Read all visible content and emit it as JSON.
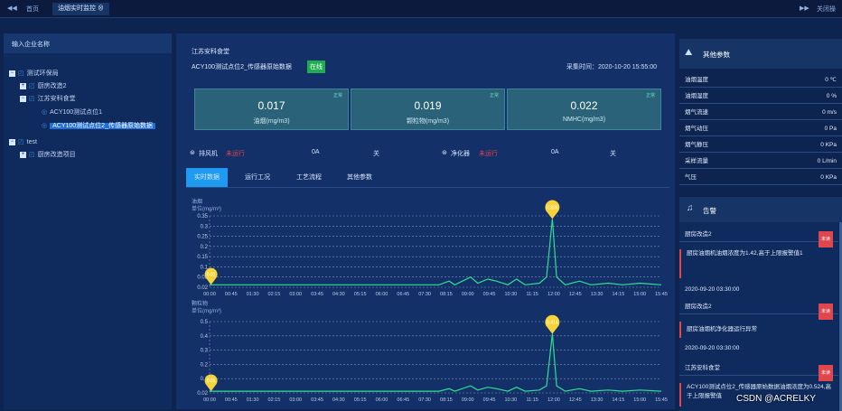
{
  "topbar": {
    "back_icon": "double-left",
    "home": "首页",
    "tab": "油烟实时监控",
    "fwd_icon": "double-right",
    "close_all": "关闭操"
  },
  "sidebar": {
    "header": "输入企业名称",
    "tree": [
      {
        "label": "测试环保局",
        "expand": "−"
      },
      {
        "label": "厨房改造2",
        "expand": "+"
      },
      {
        "label": "江苏安科食堂",
        "expand": "−"
      },
      {
        "label": "ACY100测试点位1"
      },
      {
        "label": "ACY100测试点位2_传感器原始数据"
      },
      {
        "label": "test",
        "expand": "−"
      },
      {
        "label": "厨房改造项目",
        "expand": "+"
      }
    ]
  },
  "main": {
    "company": "江苏安科食堂",
    "device": "ACY100测试点位2_传感器原始数据",
    "online": "在线",
    "time": "采集时间：2020-10-20 15:55:00",
    "cards": [
      {
        "value": "0.017",
        "label": "油烟(mg/m3)",
        "status": "正常"
      },
      {
        "value": "0.019",
        "label": "颗粒物(mg/m3)",
        "status": "正常"
      },
      {
        "value": "0.022",
        "label": "NMHC(mg/m3)",
        "status": "正常"
      }
    ],
    "fan": {
      "name": "排风机",
      "status": "未运行",
      "current": "0A",
      "switch": "关"
    },
    "purifier": {
      "name": "净化器",
      "status": "未运行",
      "current": "0A",
      "switch": "关"
    },
    "tabs": [
      "实时数据",
      "运行工况",
      "工艺流程",
      "其他参数"
    ]
  },
  "chart_data": [
    {
      "type": "line",
      "title": "油烟",
      "ylabel": "单位(mg/m³)",
      "ylim": [
        0,
        0.35
      ],
      "yticks": [
        "0.35",
        "0.3",
        "0.25",
        "0.2",
        "0.15",
        "0.1",
        "0.05",
        "0.02"
      ],
      "x": [
        "00:00",
        "00:45",
        "01:30",
        "02:15",
        "03:00",
        "03:45",
        "04:30",
        "05:15",
        "06:00",
        "06:45",
        "07:30",
        "08:15",
        "09:00",
        "09:45",
        "10:30",
        "11:15",
        "12:00",
        "12:45",
        "13:30",
        "14:15",
        "15:00",
        "15:45"
      ],
      "peak_max": "0.335",
      "peak_min": "0.01",
      "color": "#2ee08f"
    },
    {
      "type": "line",
      "title": "颗粒物",
      "ylabel": "单位(mg/m³)",
      "ylim": [
        0,
        0.5
      ],
      "yticks": [
        "0.5",
        "0.4",
        "0.3",
        "0.2",
        "0.1",
        "0.02"
      ],
      "x": [
        "00:00",
        "00:45",
        "01:30",
        "02:15",
        "03:00",
        "03:45",
        "04:30",
        "05:15",
        "06:00",
        "06:45",
        "07:30",
        "08:15",
        "09:00",
        "09:45",
        "10:30",
        "11:15",
        "12:00",
        "12:45",
        "13:30",
        "14:15",
        "15:00",
        "15:45"
      ],
      "peak_max": "0.414",
      "peak_min": "0.01",
      "color": "#2ee08f"
    }
  ],
  "params": {
    "title": "其他参数",
    "rows": [
      {
        "k": "油烟温度",
        "v": "0 ℃"
      },
      {
        "k": "油烟湿度",
        "v": "0 %"
      },
      {
        "k": "烟气流速",
        "v": "0 m/s"
      },
      {
        "k": "烟气动压",
        "v": "0 Pa"
      },
      {
        "k": "烟气静压",
        "v": "0 KPa"
      },
      {
        "k": "采样流量",
        "v": "0 L/min"
      },
      {
        "k": "气压",
        "v": "0 KPa"
      }
    ]
  },
  "alarms": {
    "title": "告警",
    "badge": "未读",
    "items": [
      {
        "site": "厨房改造2",
        "msg": "厨房油烟机油烟浓度为1.42,高于上限报警值1",
        "time": "2020-09-20 03:30:00"
      },
      {
        "site": "厨房改造2",
        "msg": "厨房油烟机净化器运行异常",
        "time": "2020-09-20 03:30:00"
      },
      {
        "site": "江苏安科食堂",
        "msg": "ACY100测试点位2_传感器原始数据油烟浓度为0.524,高于上限报警值"
      }
    ]
  },
  "watermark": "CSDN @ACRELKY"
}
